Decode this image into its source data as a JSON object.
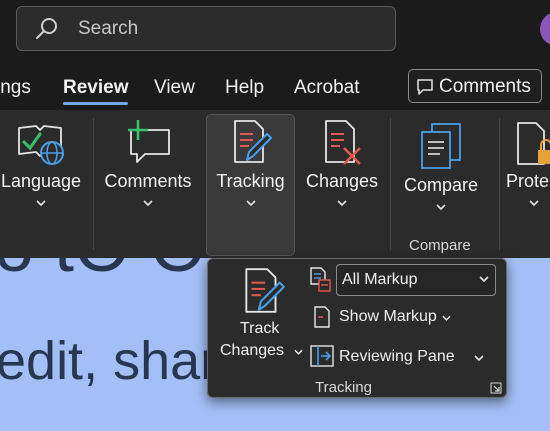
{
  "search": {
    "placeholder": "Search"
  },
  "tabs": [
    {
      "label": "ings"
    },
    {
      "label": "Review"
    },
    {
      "label": "View"
    },
    {
      "label": "Help"
    },
    {
      "label": "Acrobat"
    }
  ],
  "comments_button": {
    "label": "Comments"
  },
  "ribbon": {
    "language": "Language",
    "comments": "Comments",
    "tracking": "Tracking",
    "changes": "Changes",
    "compare": "Compare",
    "protect": "Prote",
    "compare_group_label": "Compare"
  },
  "document": {
    "line1": "o tO O",
    "line2": "edit, shar"
  },
  "tracking_flyout": {
    "track_changes_line1": "Track",
    "track_changes_line2": "Changes",
    "markup_dropdown_value": "All Markup",
    "show_markup": "Show Markup",
    "reviewing_pane": "Reviewing Pane",
    "group_label": "Tracking"
  },
  "colors": {
    "accent": "#7aa5e6",
    "document_bg": "#a4bff7",
    "ribbon_bg": "#2b2b2b",
    "icon_red": "#e05a4f",
    "icon_blue": "#4a9ee8"
  }
}
